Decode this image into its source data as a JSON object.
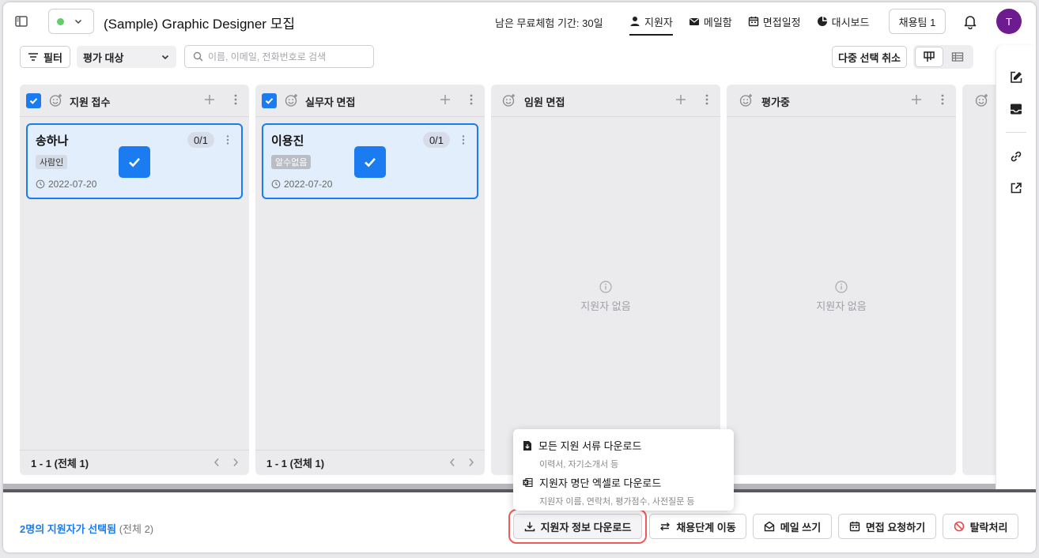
{
  "header": {
    "job_title": "(Sample) Graphic Designer 모집",
    "trial_text": "남은 무료체험 기간: 30일",
    "nav": [
      {
        "label": "지원자",
        "icon": "person-icon",
        "active": true
      },
      {
        "label": "메일함",
        "icon": "mail-icon",
        "active": false
      },
      {
        "label": "면접일정",
        "icon": "calendar-icon",
        "active": false
      },
      {
        "label": "대시보드",
        "icon": "dashboard-icon",
        "active": false
      }
    ],
    "team_button": "채용팀 1",
    "avatar_initial": "T",
    "status_color": "#5fcf6a"
  },
  "toolbar": {
    "filter_label": "필터",
    "eval_select": "평가 대상",
    "search_placeholder": "이름, 이메일, 전화번호로 검색",
    "multi_select_cancel": "다중 선택 취소"
  },
  "columns": [
    {
      "title": "지원 접수",
      "checked": true,
      "footer": "1 - 1 (전체 1)",
      "card": {
        "name": "송하나",
        "count": "0/1",
        "tag": "사람인",
        "date": "2022-07-20"
      }
    },
    {
      "title": "실무자 면접",
      "checked": true,
      "footer": "1 - 1 (전체 1)",
      "card": {
        "name": "이용진",
        "count": "0/1",
        "tag": "알수없음",
        "date": "2022-07-20"
      }
    },
    {
      "title": "임원 면접",
      "checked": false,
      "empty_text": "지원자 없음"
    },
    {
      "title": "평가중",
      "checked": false,
      "empty_text": "지원자 없음"
    }
  ],
  "bottom_bar": {
    "selected_highlight": "2명의 지원자가 선택됨",
    "selected_total": "(전체 2)",
    "actions": {
      "download": "지원자 정보 다운로드",
      "move_stage": "채용단계 이동",
      "write_mail": "메일 쓰기",
      "interview_request": "면접 요청하기",
      "reject": "탈락처리"
    }
  },
  "download_menu": {
    "items": [
      {
        "title": "모든 지원 서류 다운로드",
        "subtitle": "이력서, 자기소개서 등"
      },
      {
        "title": "지원자 명단 엑셀로 다운로드",
        "subtitle": "지원자 이름, 연락처, 평가점수, 사전질문 등"
      }
    ]
  },
  "colors": {
    "accent": "#1a7cf0",
    "danger": "#ee5b5b",
    "avatar": "#6d1b8f"
  }
}
